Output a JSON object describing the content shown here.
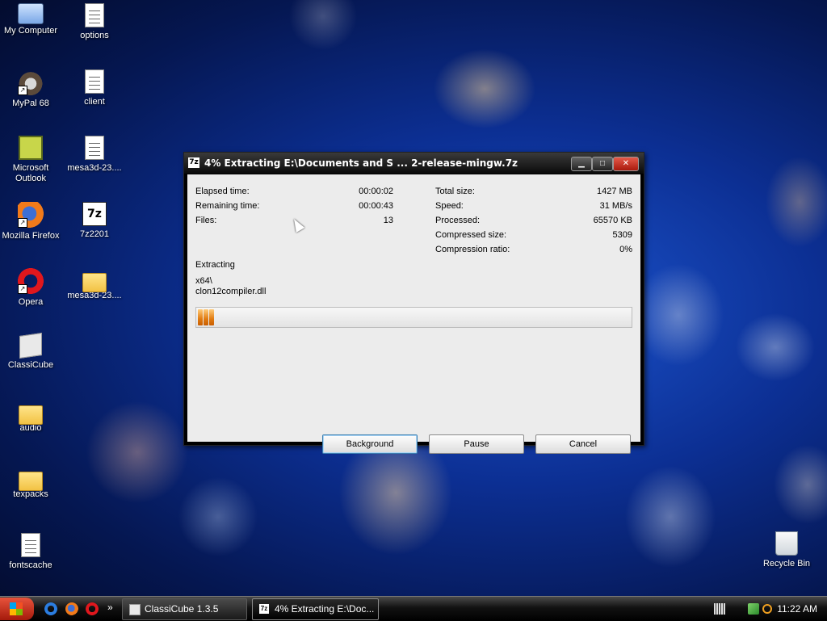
{
  "desktop": {
    "icons_left": [
      {
        "label": "My Computer",
        "icon": "computer-icon"
      },
      {
        "label": "MyPal 68",
        "icon": "mypal-icon"
      },
      {
        "label": "Microsoft Outlook",
        "icon": "outlook-icon"
      },
      {
        "label": "Mozilla Firefox",
        "icon": "firefox-icon"
      },
      {
        "label": "Opera",
        "icon": "opera-icon"
      },
      {
        "label": "ClassiCube",
        "icon": "classicube-icon"
      },
      {
        "label": "audio",
        "icon": "folder-icon"
      },
      {
        "label": "texpacks",
        "icon": "folder-icon"
      },
      {
        "label": "fontscache",
        "icon": "document-icon"
      }
    ],
    "icons_right": [
      {
        "label": "options",
        "icon": "document-icon"
      },
      {
        "label": "client",
        "icon": "document-icon"
      },
      {
        "label": "mesa3d-23....",
        "icon": "archive-icon"
      },
      {
        "label": "7z2201",
        "icon": "7zip-icon"
      },
      {
        "label": "mesa3d-23....",
        "icon": "folder-icon"
      }
    ],
    "recycle_bin": {
      "label": "Recycle Bin",
      "icon": "recycle-bin-icon"
    },
    "seven_zip_glyph": "7z"
  },
  "dialog": {
    "title": "4% Extracting E:\\Documents and S ... 2-release-mingw.7z",
    "app_icon_text": "7z",
    "controls": {
      "minimize": "▁",
      "maximize": "□",
      "close": "✕"
    },
    "left_stats": [
      {
        "label": "Elapsed time:",
        "value": "00:00:02"
      },
      {
        "label": "Remaining time:",
        "value": "00:00:43"
      },
      {
        "label": "Files:",
        "value": "13"
      }
    ],
    "right_stats": [
      {
        "label": "Total size:",
        "value": "1427 MB"
      },
      {
        "label": "Speed:",
        "value": "31 MB/s"
      },
      {
        "label": "Processed:",
        "value": "65570 KB"
      },
      {
        "label": "Compressed size:",
        "value": "5309"
      },
      {
        "label": "Compression ratio:",
        "value": "0%"
      }
    ],
    "status_label": "Extracting",
    "current_path": "x64\\",
    "current_file": "clon12compiler.dll",
    "progress_percent": 4,
    "buttons": {
      "background": "Background",
      "pause": "Pause",
      "cancel": "Cancel"
    }
  },
  "taskbar": {
    "quick_launch": [
      "ie-icon",
      "firefox-icon",
      "opera-icon"
    ],
    "overflow": "»",
    "tasks": [
      {
        "label": "ClassiCube 1.3.5",
        "active": false
      },
      {
        "label": "4% Extracting E:\\Doc...",
        "active": true
      }
    ],
    "clock": "11:22 AM"
  },
  "colors": {
    "progress": "#e07a10",
    "titlebar": "#0a0a0a",
    "dialog_bg": "#ececec",
    "start": "#c0261a"
  }
}
